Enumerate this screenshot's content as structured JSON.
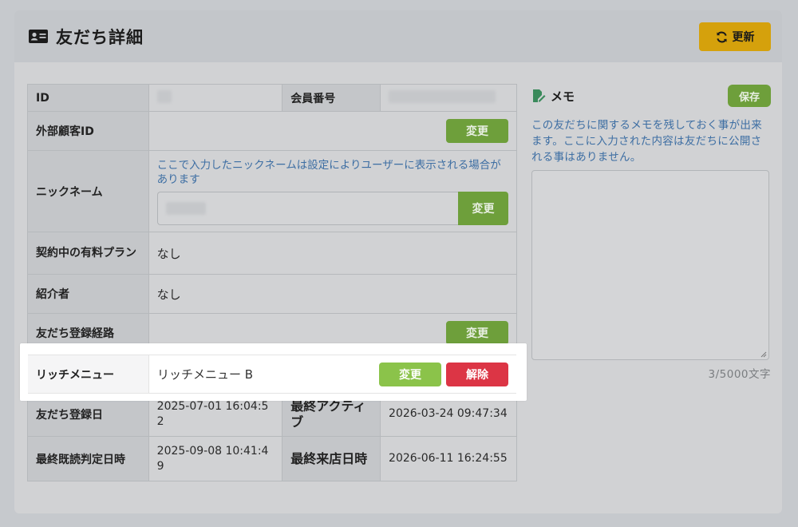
{
  "header": {
    "title": "友だち詳細",
    "icon": "id-card-icon",
    "refresh_label": "更新",
    "accent": "#d5a10c"
  },
  "table": {
    "id_label": "ID",
    "member_no_label": "会員番号",
    "external_id_label": "外部顧客ID",
    "external_id_button": "変更",
    "nickname_label": "ニックネーム",
    "nickname_note": "ここで入力したニックネームは設定によりユーザーに表示される場合があります",
    "nickname_button": "変更",
    "plan_label": "契約中の有料プラン",
    "plan_value": "なし",
    "referrer_label": "紹介者",
    "referrer_value": "なし",
    "route_label": "友だち登録経路",
    "route_button": "変更",
    "rich_menu_label": "リッチメニュー",
    "rich_menu_value": "リッチメニュー B",
    "rich_menu_change": "変更",
    "rich_menu_remove": "解除",
    "registered_label": "友だち登録日",
    "registered_value": "2025-07-01 16:04:52",
    "last_active_label": "最終アクティブ",
    "last_active_value": "2026-03-24 09:47:34",
    "last_read_label": "最終既読判定日時",
    "last_read_value": "2025-09-08 10:41:49",
    "last_visit_label": "最終来店日時",
    "last_visit_value": "2026-06-11 16:24:55"
  },
  "memo": {
    "title": "メモ",
    "icon": "edit-note-icon",
    "save_label": "保存",
    "description": "この友だちに関するメモを残しておく事が出来ます。ここに入力された内容は友だちに公開される事はありません。",
    "counter": "3/5000文字"
  },
  "colors": {
    "green": "#6e9f3b",
    "green_bright": "#8bc34a",
    "red": "#dc3545",
    "link_blue": "#3d6ea3"
  }
}
